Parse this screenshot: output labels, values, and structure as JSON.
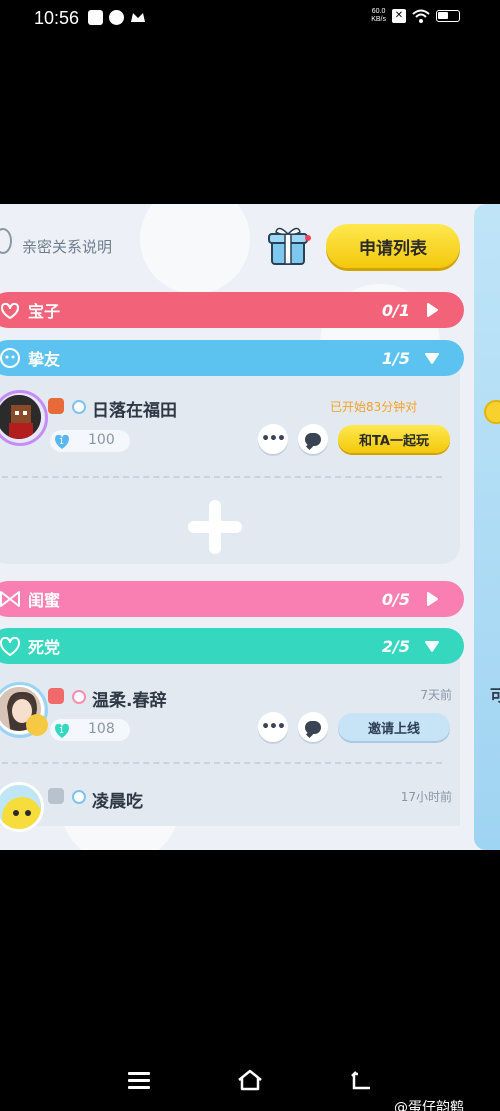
{
  "status_bar": {
    "time": "10:56",
    "net_speed_value": "60.0",
    "net_speed_unit": "KB/s"
  },
  "header": {
    "info_label": "亲密关系说明",
    "apply_list_button": "申请列表"
  },
  "categories": [
    {
      "label": "宝子",
      "count": "0/1",
      "color": "#f2637a",
      "expanded": false
    },
    {
      "label": "挚友",
      "count": "1/5",
      "color": "#5cc3f1",
      "expanded": true
    },
    {
      "label": "闺蜜",
      "count": "0/5",
      "color": "#f97fb3",
      "expanded": false
    },
    {
      "label": "死党",
      "count": "2/5",
      "color": "#35d7bf",
      "expanded": true
    }
  ],
  "friends": [
    {
      "name": "日落在福田",
      "status": "已开始83分钟对",
      "level": "100",
      "level_num": "1",
      "action": "和TA一起玩"
    },
    {
      "name": "温柔.春辞",
      "status": "7天前",
      "level": "108",
      "level_num": "1",
      "action": "邀请上线"
    },
    {
      "name": "凌晨吃",
      "status": "17小时前"
    }
  ],
  "side_panel_char": "可",
  "watermark": "@蛋仔韵鹤",
  "icons": [
    "wifi-icon",
    "battery-icon",
    "gift-icon",
    "more-icon",
    "chat-icon",
    "plus-icon",
    "menu-icon",
    "home-icon",
    "back-icon"
  ]
}
